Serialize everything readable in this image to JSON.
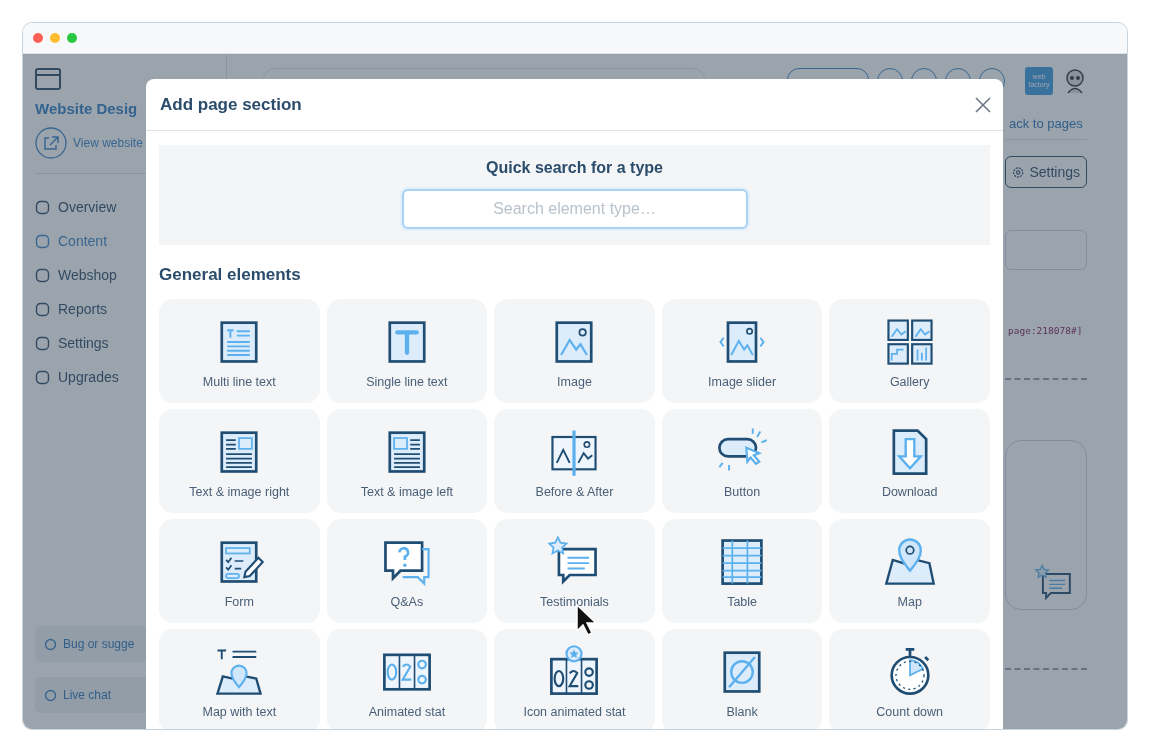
{
  "sidebar": {
    "title": "Website Desig",
    "view_link": "View website",
    "items": [
      {
        "label": "Overview",
        "selected": false
      },
      {
        "label": "Content",
        "selected": true
      },
      {
        "label": "Webshop",
        "selected": false
      },
      {
        "label": "Reports",
        "selected": false
      },
      {
        "label": "Settings",
        "selected": false
      },
      {
        "label": "Upgrades",
        "selected": false
      }
    ],
    "footer_buttons": [
      "Bug or sugge",
      "Live chat"
    ]
  },
  "topbar": {
    "logo": "web factory"
  },
  "main": {
    "back_link": "ack to pages",
    "settings_button": "Settings",
    "code_text": "page:218078#]"
  },
  "modal": {
    "title": "Add page section",
    "search": {
      "title": "Quick search for a type",
      "placeholder": "Search element type…"
    },
    "section_title": "General elements",
    "elements": [
      {
        "label": "Multi line text"
      },
      {
        "label": "Single line text"
      },
      {
        "label": "Image"
      },
      {
        "label": "Image slider"
      },
      {
        "label": "Gallery"
      },
      {
        "label": "Text & image right"
      },
      {
        "label": "Text & image left"
      },
      {
        "label": "Before & After"
      },
      {
        "label": "Button"
      },
      {
        "label": "Download"
      },
      {
        "label": "Form"
      },
      {
        "label": "Q&As"
      },
      {
        "label": "Testimonials"
      },
      {
        "label": "Table"
      },
      {
        "label": "Map"
      },
      {
        "label": "Map with text"
      },
      {
        "label": "Animated stat"
      },
      {
        "label": "Icon animated stat"
      },
      {
        "label": "Blank"
      },
      {
        "label": "Count down"
      }
    ]
  }
}
